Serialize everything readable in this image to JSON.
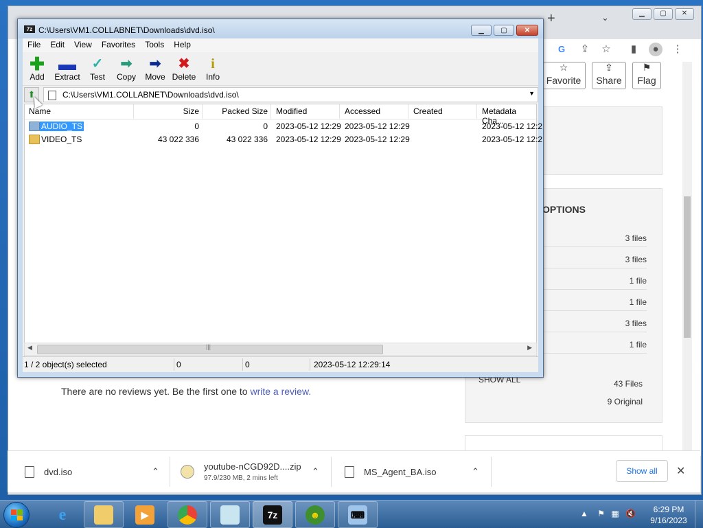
{
  "zip_window": {
    "title": "C:\\Users\\VM1.COLLABNET\\Downloads\\dvd.iso\\",
    "menu": [
      "File",
      "Edit",
      "View",
      "Favorites",
      "Tools",
      "Help"
    ],
    "toolbar": [
      {
        "label": "Add",
        "icon": "plus-icon",
        "color": "#1aa31a"
      },
      {
        "label": "Extract",
        "icon": "minus-icon",
        "color": "#1a37b8"
      },
      {
        "label": "Test",
        "icon": "check-icon",
        "color": "#2ab3a6"
      },
      {
        "label": "Copy",
        "icon": "arrow-right-icon",
        "color": "#2a9a7a"
      },
      {
        "label": "Move",
        "icon": "arrow-right-icon",
        "color": "#0f2b8f"
      },
      {
        "label": "Delete",
        "icon": "x-icon",
        "color": "#d11b1b"
      },
      {
        "label": "Info",
        "icon": "info-icon",
        "color": "#b59a00"
      }
    ],
    "address": "C:\\Users\\VM1.COLLABNET\\Downloads\\dvd.iso\\",
    "columns": [
      "Name",
      "Size",
      "Packed Size",
      "Modified",
      "Accessed",
      "Created",
      "Metadata Cha..."
    ],
    "rows": [
      {
        "name": "AUDIO_TS",
        "size": "0",
        "packed": "0",
        "modified": "2023-05-12 12:29",
        "accessed": "2023-05-12 12:29",
        "created": "",
        "metadata": "2023-05-12 12:2",
        "selected": true
      },
      {
        "name": "VIDEO_TS",
        "size": "43 022 336",
        "packed": "43 022 336",
        "modified": "2023-05-12 12:29",
        "accessed": "2023-05-12 12:29",
        "created": "",
        "metadata": "2023-05-12 12:2",
        "selected": false
      }
    ],
    "status": {
      "selection": "1 / 2 object(s) selected",
      "size": "0",
      "packed": "0",
      "date": "2023-05-12 12:29:14"
    }
  },
  "browser": {
    "page_buttons": [
      "Favorite",
      "Share",
      "Flag"
    ],
    "options_title": "OPTIONS",
    "option_counts": [
      "3 files",
      "3 files",
      "1 file",
      "1 file",
      "3 files",
      "1 file"
    ],
    "show_all": "SHOW ALL",
    "files_count": "43 Files",
    "original_count": "9 Original",
    "review_text": "There are no reviews yet. Be the first one to ",
    "review_link": "write a review."
  },
  "downloads": {
    "items": [
      {
        "name": "dvd.iso",
        "sub": ""
      },
      {
        "name": "youtube-nCGD92D....zip",
        "sub": "97.9/230 MB, 2 mins left"
      },
      {
        "name": "MS_Agent_BA.iso",
        "sub": ""
      }
    ],
    "show_all": "Show all"
  },
  "taskbar": {
    "time": "6:29 PM",
    "date": "9/16/2023"
  }
}
